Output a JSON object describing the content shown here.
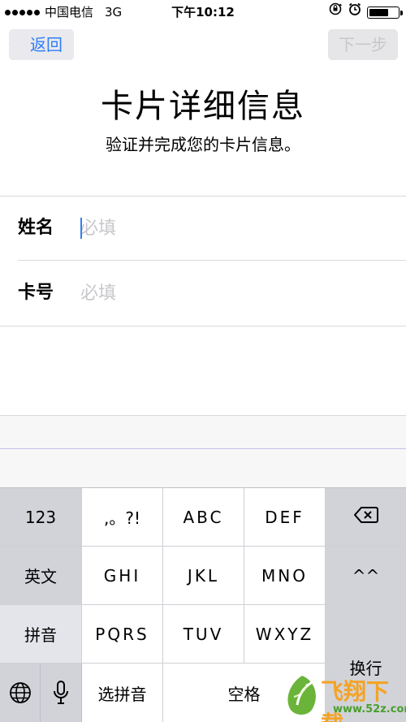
{
  "status_bar": {
    "carrier": "中国电信",
    "network": "3G",
    "time": "下午10:12",
    "battery_level": 0.7
  },
  "nav": {
    "back_label": "返回",
    "next_label": "下一步"
  },
  "header": {
    "title": "卡片详细信息",
    "subtitle": "验证并完成您的卡片信息。"
  },
  "form": {
    "name": {
      "label": "姓名",
      "placeholder": "必填"
    },
    "card_number": {
      "label": "卡号",
      "placeholder": "必填"
    }
  },
  "keyboard": {
    "row1": [
      "123",
      ",。?!",
      "ABC",
      "DEF"
    ],
    "row2": [
      "英文",
      "GHI",
      "JKL",
      "MNO",
      "^^"
    ],
    "row3": [
      "拼音",
      "PQRS",
      "TUV",
      "WXYZ"
    ],
    "select_pinyin": "选拼音",
    "space": "空格",
    "return": "换行",
    "icons": [
      "delete-icon",
      "globe-icon",
      "microphone-icon"
    ]
  },
  "watermark": {
    "text": "飞翔下载",
    "url": "www.52z.com"
  },
  "colors": {
    "accent": "#2f7ef6",
    "key_function_bg": "#d1d3d9",
    "placeholder": "#c7c7cc"
  }
}
